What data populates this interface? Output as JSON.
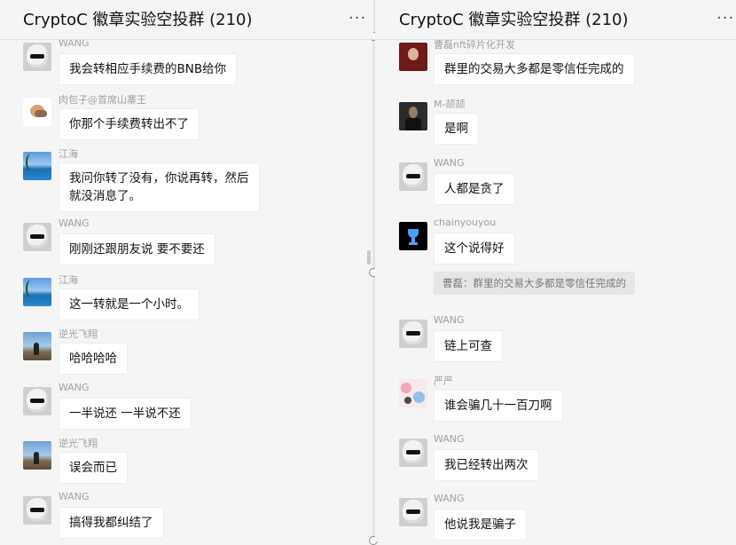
{
  "left_panel": {
    "title": "CryptoC 徽章实验空投群 (210)",
    "more_icon": "more-dots-icon",
    "messages": [
      {
        "sender": "WANG",
        "text": "我会转相应手续费的BNB给你",
        "avatar": "avatar-wang"
      },
      {
        "sender": "肉包子@首席山寨王",
        "text": "你那个手续费转出不了",
        "avatar": "avatar-meat"
      },
      {
        "sender": "江海",
        "text": "我问你转了没有，你说再转，然后",
        "text2": "就没消息了。",
        "avatar": "avatar-sea"
      },
      {
        "sender": "WANG",
        "text": "刚刚还跟朋友说 要不要还",
        "avatar": "avatar-wang"
      },
      {
        "sender": "江海",
        "text": "这一转就是一个小时。",
        "avatar": "avatar-sea"
      },
      {
        "sender": "逆光飞翔",
        "text": "哈哈哈哈",
        "avatar": "avatar-shore"
      },
      {
        "sender": "WANG",
        "text": "一半说还 一半说不还",
        "avatar": "avatar-wang"
      },
      {
        "sender": "逆光飞翔",
        "text": "误会而已",
        "avatar": "avatar-shore"
      },
      {
        "sender": "WANG",
        "text": "搞得我都纠结了",
        "avatar": "avatar-wang"
      }
    ]
  },
  "right_panel": {
    "title": "CryptoC 徽章实验空投群 (210)",
    "more_icon": "more-dots-icon",
    "messages": [
      {
        "sender": "曹磊nft碎片化开发",
        "text": "群里的交易大多都是零信任完成的",
        "avatar": "avatar-red"
      },
      {
        "sender": "M-颉颉",
        "text": "是啊",
        "avatar": "avatar-dark"
      },
      {
        "sender": "WANG",
        "text": "人都是贪了",
        "avatar": "avatar-wang"
      },
      {
        "sender": "chainyouyou",
        "text": "这个说得好",
        "quote": "曹磊：群里的交易大多都是零信任完成的",
        "avatar": "avatar-cup"
      },
      {
        "sender": "WANG",
        "text": "链上可查",
        "avatar": "avatar-wang"
      },
      {
        "sender": "严严",
        "text": "谁会骗几十一百刀啊",
        "avatar": "avatar-cute"
      },
      {
        "sender": "WANG",
        "text": "我已经转出两次",
        "avatar": "avatar-wang"
      },
      {
        "sender": "WANG",
        "text": "他说我是骗子",
        "avatar": "avatar-wang"
      }
    ]
  }
}
